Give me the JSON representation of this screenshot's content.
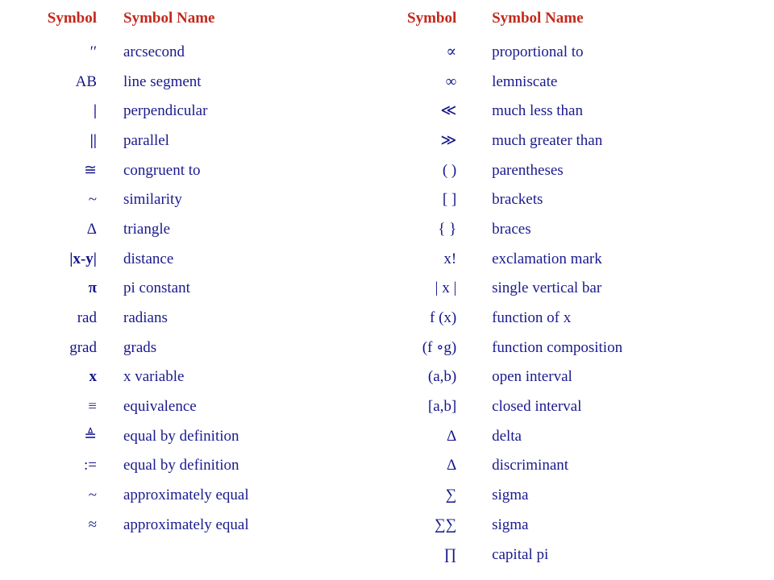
{
  "colors": {
    "header_red": "#C4281C",
    "text_navy": "#1A1A8F",
    "background": "#FFFFFF"
  },
  "columns": {
    "left": {
      "header_symbol": "Symbol",
      "header_name": "Symbol Name",
      "rows": [
        {
          "symbol": "′′",
          "name": "arcsecond"
        },
        {
          "symbol": "AB",
          "name": "line segment"
        },
        {
          "symbol": "|",
          "name": "perpendicular"
        },
        {
          "symbol": "||",
          "name": "parallel"
        },
        {
          "symbol": "≅",
          "name": "congruent to"
        },
        {
          "symbol": "~",
          "name": "similarity"
        },
        {
          "symbol": "Δ",
          "name": "triangle"
        },
        {
          "symbol": "|x-y|",
          "name": "distance"
        },
        {
          "symbol": "π",
          "name": "pi constant"
        },
        {
          "symbol": "rad",
          "name": "radians"
        },
        {
          "symbol": "grad",
          "name": "grads"
        },
        {
          "symbol": "x",
          "name": "x variable"
        },
        {
          "symbol": "≡",
          "name": "equivalence"
        },
        {
          "symbol": "≜",
          "name": "equal by definition"
        },
        {
          "symbol": ":=",
          "name": "equal by definition"
        },
        {
          "symbol": "~",
          "name": "approximately equal"
        },
        {
          "symbol": "≈",
          "name": "approximately equal"
        }
      ]
    },
    "right": {
      "header_symbol": "Symbol",
      "header_name": "Symbol Name",
      "rows": [
        {
          "symbol": "∝",
          "name": "proportional to"
        },
        {
          "symbol": "∞",
          "name": "lemniscate"
        },
        {
          "symbol": "≪",
          "name": "much less than"
        },
        {
          "symbol": "≫",
          "name": "much greater than"
        },
        {
          "symbol": "( )",
          "name": "parentheses"
        },
        {
          "symbol": "[ ]",
          "name": "brackets"
        },
        {
          "symbol": "{ }",
          "name": "braces"
        },
        {
          "symbol": "x!",
          "name": "exclamation mark"
        },
        {
          "symbol": "| x |",
          "name": "single vertical bar"
        },
        {
          "symbol": "f (x)",
          "name": "function of x"
        },
        {
          "symbol": "(f ∘g)",
          "name": "function composition"
        },
        {
          "symbol": "(a,b)",
          "name": "open interval"
        },
        {
          "symbol": "[a,b]",
          "name": "closed interval"
        },
        {
          "symbol": "Δ",
          "name": "delta"
        },
        {
          "symbol": "Δ",
          "name": "discriminant"
        },
        {
          "symbol": "∑",
          "name": "sigma"
        },
        {
          "symbol": "∑∑",
          "name": "sigma"
        },
        {
          "symbol": "∏",
          "name": "capital pi"
        }
      ]
    }
  }
}
